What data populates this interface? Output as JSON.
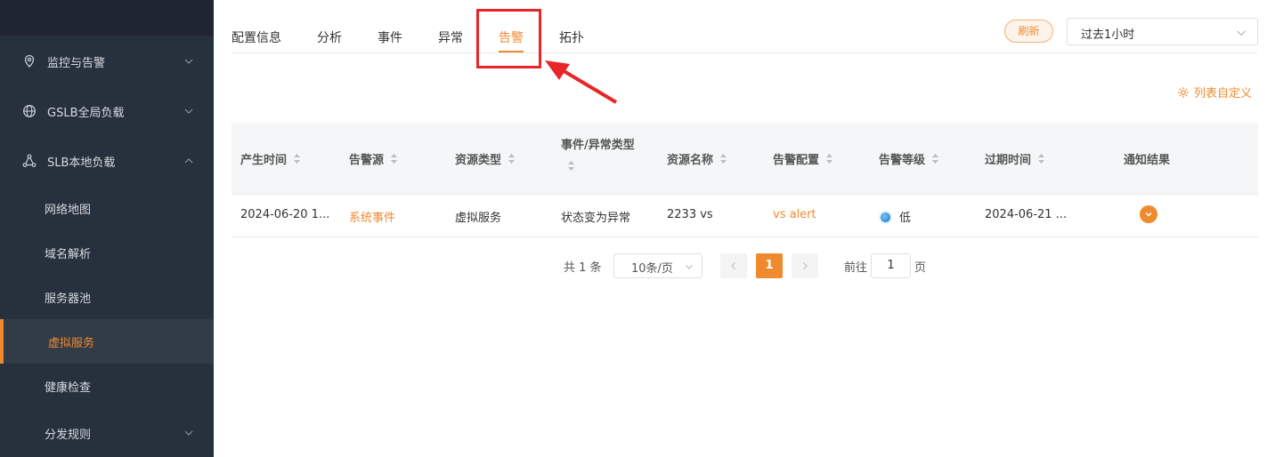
{
  "sidebar": {
    "groups": [
      {
        "label": "监控与告警",
        "icon": "location-pin-icon"
      },
      {
        "label": "GSLB全局负载",
        "icon": "globe-icon"
      },
      {
        "label": "SLB本地负载",
        "icon": "share-nodes-icon"
      }
    ],
    "items": [
      {
        "label": "网络地图"
      },
      {
        "label": "域名解析"
      },
      {
        "label": "服务器池"
      },
      {
        "label": "虚拟服务"
      },
      {
        "label": "健康检查"
      },
      {
        "label": "分发规则"
      }
    ]
  },
  "tabs": [
    {
      "label": "配置信息"
    },
    {
      "label": "分析"
    },
    {
      "label": "事件"
    },
    {
      "label": "异常"
    },
    {
      "label": "告警"
    },
    {
      "label": "拓扑"
    }
  ],
  "active_tab": "告警",
  "toolbar": {
    "refresh_label": "刷新",
    "time_range": "过去1小时"
  },
  "customize_label": "列表自定义",
  "table": {
    "columns": [
      {
        "label": "产生时间",
        "sortable": true
      },
      {
        "label": "告警源",
        "sortable": true
      },
      {
        "label": "资源类型",
        "sortable": true
      },
      {
        "label": "事件/异常类型",
        "sortable": true
      },
      {
        "label": "资源名称",
        "sortable": true
      },
      {
        "label": "告警配置",
        "sortable": true
      },
      {
        "label": "告警等级",
        "sortable": true
      },
      {
        "label": "过期时间",
        "sortable": true
      },
      {
        "label": "通知结果",
        "sortable": false
      }
    ],
    "rows": [
      {
        "created": "2024-06-20 1...",
        "source": "系统事件",
        "resource_type": "虚拟服务",
        "event_type": "状态变为异常",
        "resource_name": "2233 vs",
        "alert_config": "vs alert",
        "level": "低",
        "expires": "2024-06-21 ..."
      }
    ]
  },
  "pagination": {
    "total_label": "共 1 条",
    "page_size": "10条/页",
    "current_page": "1",
    "goto_prefix": "前往",
    "goto_value": "1",
    "goto_suffix": "页"
  },
  "colors": {
    "accent": "#f08a2e",
    "sidebar_bg": "#27303d",
    "highlight": "#e8262a"
  }
}
